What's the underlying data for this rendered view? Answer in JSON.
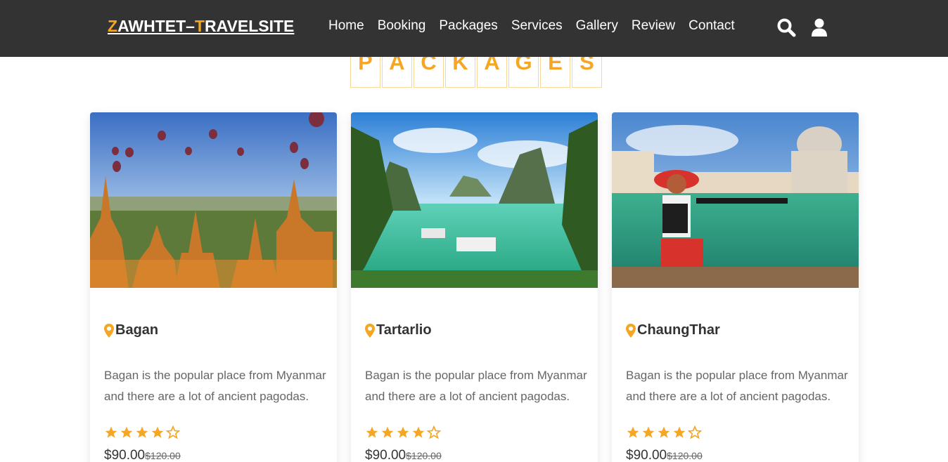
{
  "header": {
    "logo_z": "Z",
    "logo_mid": "AWHTET–",
    "logo_t": "T",
    "logo_rest": "RAVELSITE",
    "nav": [
      "Home",
      "Booking",
      "Packages",
      "Services",
      "Gallery",
      "Review",
      "Contact"
    ],
    "icons": [
      "search-icon",
      "user-icon"
    ]
  },
  "section": {
    "heading_letters": [
      "P",
      "A",
      "C",
      "K",
      "A",
      "G",
      "E",
      "S"
    ]
  },
  "cards": [
    {
      "title": "Bagan",
      "desc": "Bagan is the popular place from Myanmar and there are a lot of ancient pagodas.",
      "rating": 4,
      "price": "$90.00",
      "old_price": "$120.00"
    },
    {
      "title": "Tartarlio",
      "desc": "Bagan is the popular place from Myanmar and there are a lot of ancient pagodas.",
      "rating": 4,
      "price": "$90.00",
      "old_price": "$120.00"
    },
    {
      "title": "ChaungThar",
      "desc": "Bagan is the popular place from Myanmar and there are a lot of ancient pagodas.",
      "rating": 4,
      "price": "$90.00",
      "old_price": "$120.00"
    }
  ],
  "colors": {
    "header_bg": "#333333",
    "accent": "#f5a623"
  }
}
